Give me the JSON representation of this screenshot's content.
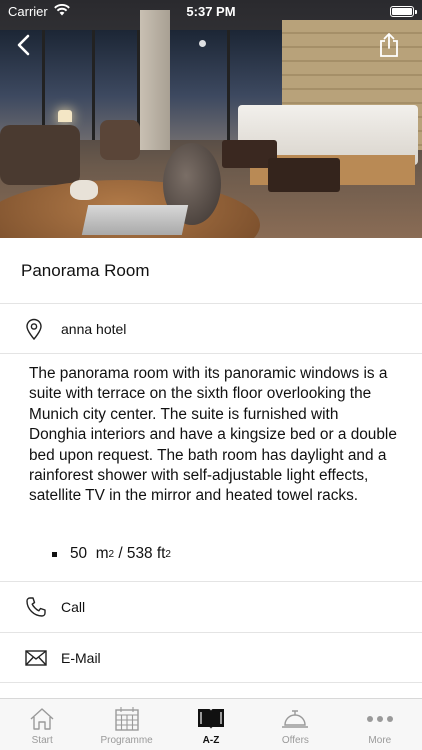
{
  "status_bar": {
    "carrier": "Carrier",
    "time": "5:37 PM"
  },
  "detail": {
    "title": "Panorama Room",
    "location": "anna hotel",
    "description": "The panorama room with its panoramic windows is a suite with terrace on the sixth floor overlooking the Munich city center. The suite is furnished with Donghia interiors and have a kingsize bed or a double bed upon request. The bath room has daylight and a rainforest shower with self-adjustable light effects, satellite TV in the mirror and heated towel racks.",
    "size": {
      "value": "50",
      "unit_m": "m",
      "unit_m_exp": "2",
      "separator": " / 538 ft",
      "unit_ft_exp": "2"
    }
  },
  "actions": {
    "call_label": "Call",
    "email_label": "E-Mail"
  },
  "tabbar": {
    "tabs": [
      {
        "label": "Start",
        "icon": "home-icon",
        "active": false
      },
      {
        "label": "Programme",
        "icon": "calendar-icon",
        "active": false
      },
      {
        "label": "A-Z",
        "icon": "book-icon",
        "active": true
      },
      {
        "label": "Offers",
        "icon": "service-bell-icon",
        "active": false
      },
      {
        "label": "More",
        "icon": "more-dots-icon",
        "active": false
      }
    ]
  },
  "colors": {
    "accent": "#111111",
    "inactive": "#9a9a9a",
    "divider": "#e4e4e4",
    "tabbar_bg": "#f7f7f7"
  }
}
